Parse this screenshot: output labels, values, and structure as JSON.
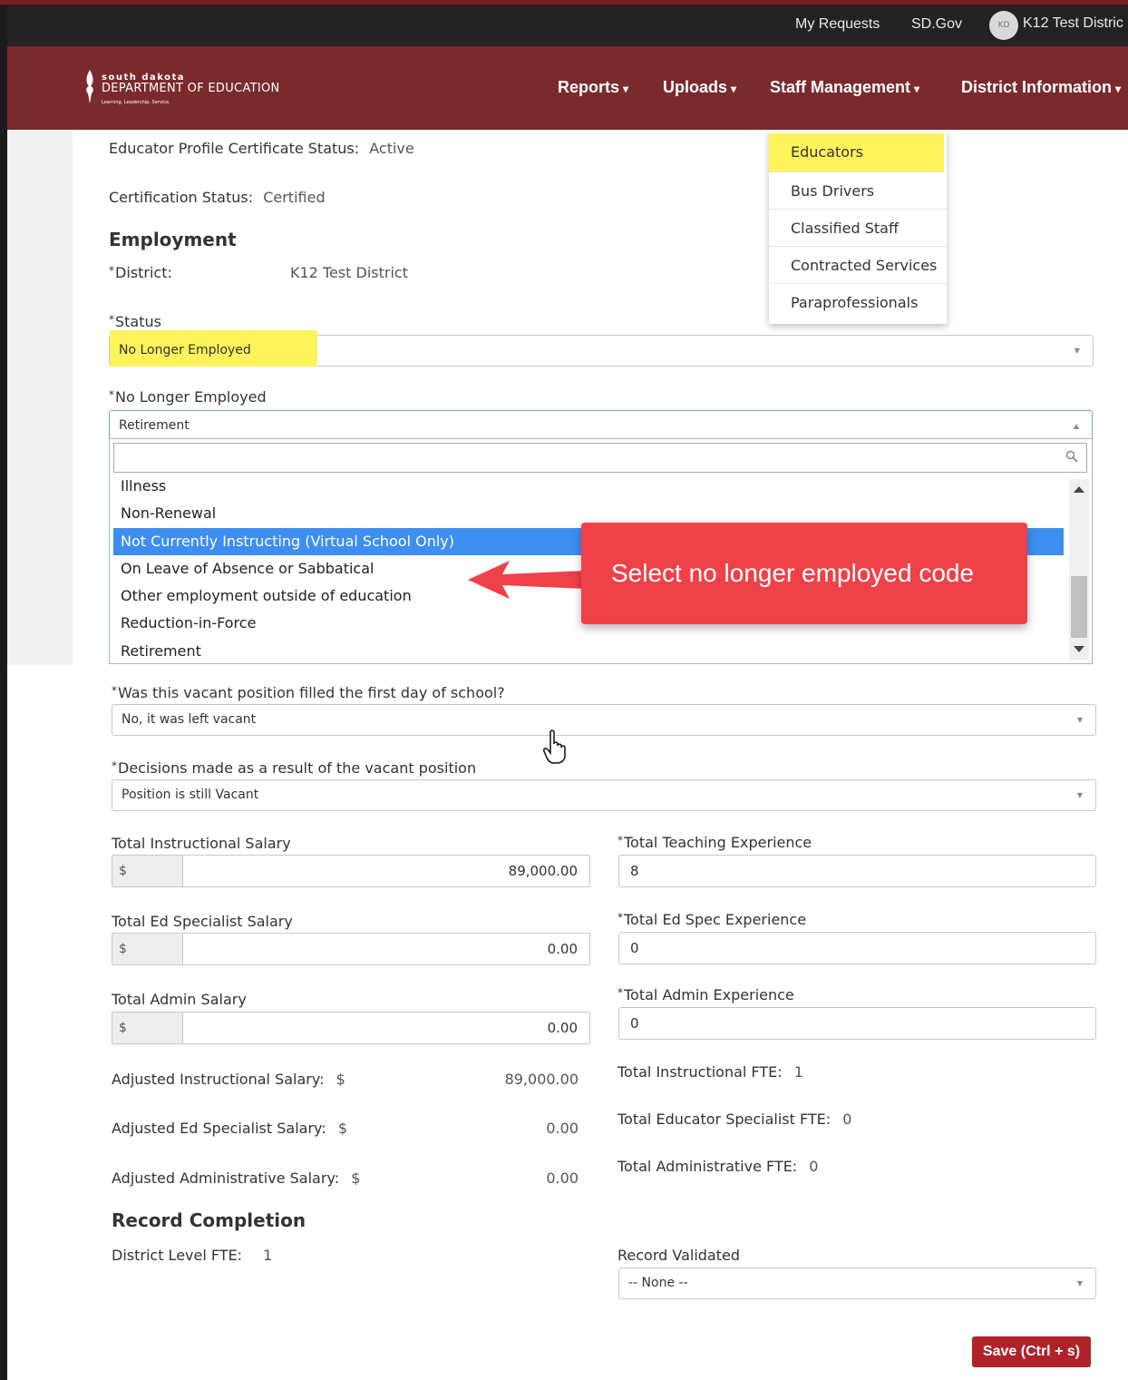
{
  "utility_bar": {
    "my_requests": "My Requests",
    "sd_gov": "SD.Gov",
    "avatar_initials": "KD",
    "user_name": "K12 Test Distric"
  },
  "logo": {
    "line1": "south dakota",
    "line2": "DEPARTMENT OF EDUCATION",
    "line3": "Learning. Leadership. Service."
  },
  "nav": {
    "reports": "Reports",
    "uploads": "Uploads",
    "staff_management": "Staff Management",
    "district_information": "District Information",
    "caret": "▾"
  },
  "staff_menu": {
    "items": [
      "Educators",
      "Bus Drivers",
      "Classified Staff",
      "Contracted Services",
      "Paraprofessionals"
    ],
    "highlighted_index": 0
  },
  "profile": {
    "cert_status_label": "Educator Profile Certificate Status:",
    "cert_status_value": "Active",
    "certification_label": "Certification Status:",
    "certification_value": "Certified"
  },
  "employment": {
    "heading": "Employment",
    "required_mark": "*",
    "district_label": "District:",
    "district_value": "K12 Test District",
    "status_label": "Status",
    "status_value": "No Longer Employed",
    "nle_label": "No Longer Employed",
    "nle_value": "Retirement",
    "search_value": "",
    "options": [
      "Illness",
      "Non-Renewal",
      "Not Currently Instructing (Virtual School Only)",
      "On Leave of Absence or Sabbatical",
      "Other employment outside of education",
      "Reduction-in-Force",
      "Retirement"
    ],
    "selected_option_index": 2,
    "vacant_label": "Was this vacant position filled the first day of school?",
    "vacant_value": "No, it was left vacant",
    "decisions_label": "Decisions made as a result of the vacant position",
    "decisions_value": "Position is still Vacant"
  },
  "callout": {
    "text": "Select no longer employed code"
  },
  "salary": {
    "currency": "$",
    "instructional_label": "Total Instructional Salary",
    "instructional_value": "89,000.00",
    "ed_specialist_label": "Total Ed Specialist Salary",
    "ed_specialist_value": "0.00",
    "admin_label": "Total Admin Salary",
    "admin_value": "0.00"
  },
  "experience": {
    "teaching_label": "Total Teaching Experience",
    "teaching_value": "8",
    "ed_spec_label": "Total Ed Spec Experience",
    "ed_spec_value": "0",
    "admin_label": "Total Admin Experience",
    "admin_value": "0"
  },
  "adjusted": {
    "instructional_label": "Adjusted Instructional Salary:",
    "instructional_value": "89,000.00",
    "ed_specialist_label": "Adjusted Ed Specialist Salary:",
    "ed_specialist_value": "0.00",
    "administrative_label": "Adjusted Administrative Salary:",
    "administrative_value": "0.00"
  },
  "fte": {
    "instructional_label": "Total Instructional FTE:",
    "instructional_value": "1",
    "educator_specialist_label": "Total Educator Specialist FTE:",
    "educator_specialist_value": "0",
    "administrative_label": "Total Administrative FTE:",
    "administrative_value": "0"
  },
  "record": {
    "heading": "Record Completion",
    "district_fte_label": "District Level FTE:",
    "district_fte_value": "1",
    "validated_label": "Record Validated",
    "validated_value": "-- None --"
  },
  "save_button": "Save (Ctrl + s)",
  "colors": {
    "brand": "#7a2a2c",
    "highlight": "#fdf35a",
    "selected_option": "#3d8ef0",
    "callout": "#ef4148",
    "save": "#b0222a"
  }
}
